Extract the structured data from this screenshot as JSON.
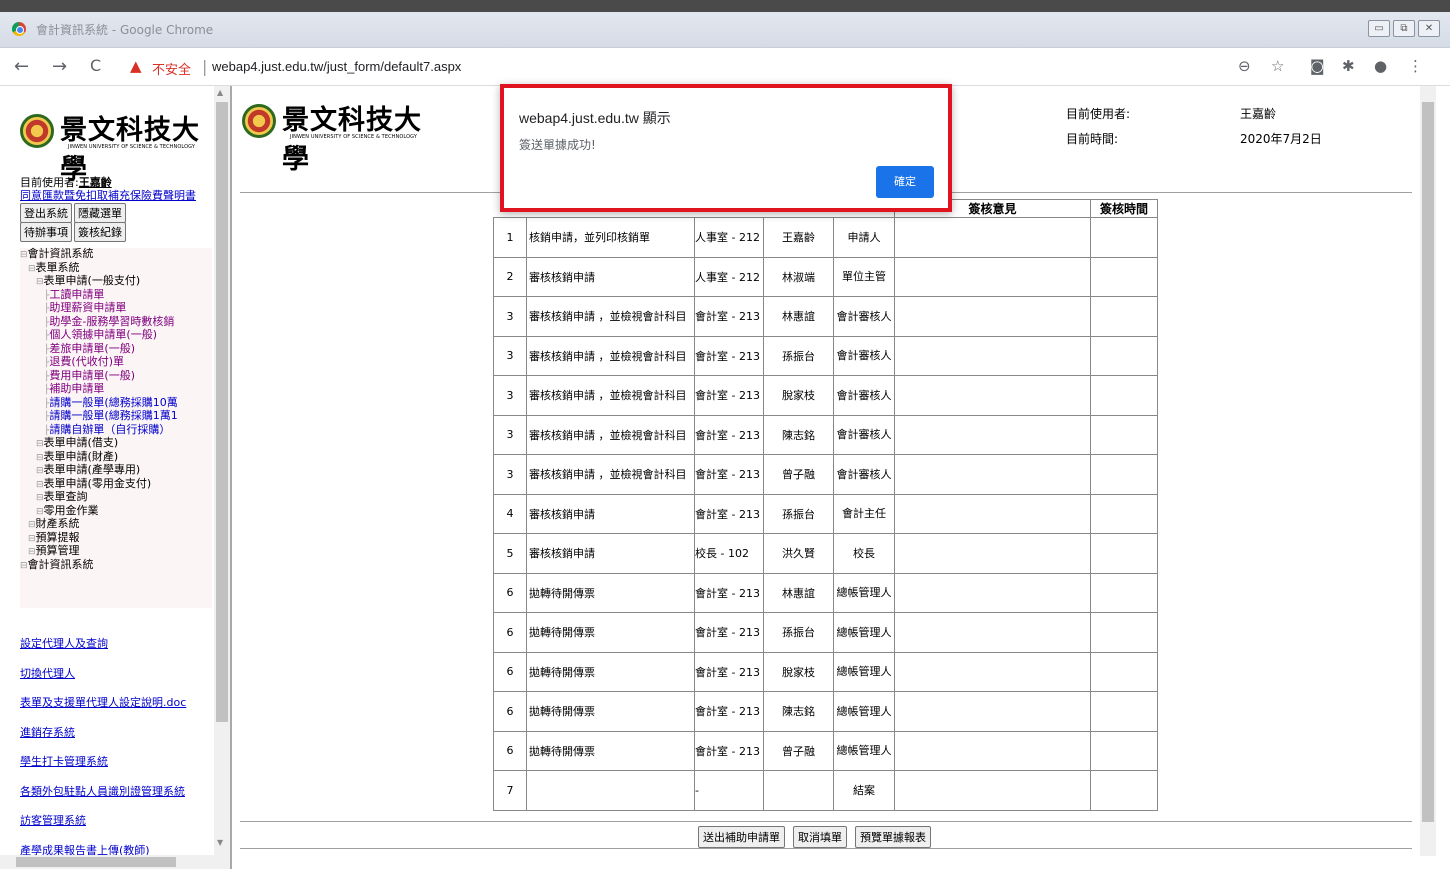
{
  "window": {
    "title": "會計資訊系統 - Google Chrome"
  },
  "browser": {
    "insecure_label": "不安全",
    "url": "webap4.just.edu.tw/just_form/default7.aspx"
  },
  "logo": {
    "cn": "景文科技大學",
    "en": "JINWEN UNIVERSITY OF SCIENCE & TECHNOLOGY"
  },
  "sidebar": {
    "user_label": "目前使用者:",
    "user_name": "王嘉齡",
    "consent_link": "同意匯款暨免扣取補充保險費聲明書",
    "buttons_row1": [
      "登出系統",
      "隱藏選單"
    ],
    "buttons_row2": [
      "待辦事項",
      "簽核紀錄"
    ],
    "tree": [
      {
        "label": "會計資訊系統",
        "level": 0,
        "type": "node"
      },
      {
        "label": "表單系統",
        "level": 1,
        "type": "node"
      },
      {
        "label": "表單申請(一般支付)",
        "level": 2,
        "type": "node"
      },
      {
        "label": "工讀申請單",
        "level": 3,
        "type": "visited"
      },
      {
        "label": "助理薪資申請單",
        "level": 3,
        "type": "visited"
      },
      {
        "label": "助學金-服務學習時數核銷",
        "level": 3,
        "type": "visited"
      },
      {
        "label": "個人領據申請單(一般)",
        "level": 3,
        "type": "visited"
      },
      {
        "label": "差旅申請單(一般)",
        "level": 3,
        "type": "visited"
      },
      {
        "label": "退費(代收付)單",
        "level": 3,
        "type": "visited"
      },
      {
        "label": "費用申請單(一般)",
        "level": 3,
        "type": "visited"
      },
      {
        "label": "補助申請單",
        "level": 3,
        "type": "visited"
      },
      {
        "label": "請購一般單(總務採購10萬",
        "level": 3,
        "type": "link"
      },
      {
        "label": "請購一般單(總務採購1萬1",
        "level": 3,
        "type": "link"
      },
      {
        "label": "請購自辦單（自行採購）",
        "level": 3,
        "type": "link"
      },
      {
        "label": "表單申請(借支)",
        "level": 2,
        "type": "node"
      },
      {
        "label": "表單申請(財產)",
        "level": 2,
        "type": "node"
      },
      {
        "label": "表單申請(產學專用)",
        "level": 2,
        "type": "node"
      },
      {
        "label": "表單申請(零用金支付)",
        "level": 2,
        "type": "node"
      },
      {
        "label": "表單查詢",
        "level": 2,
        "type": "node"
      },
      {
        "label": "零用金作業",
        "level": 2,
        "type": "node"
      },
      {
        "label": "財產系統",
        "level": 1,
        "type": "node"
      },
      {
        "label": "預算提報",
        "level": 1,
        "type": "node"
      },
      {
        "label": "預算管理",
        "level": 1,
        "type": "node"
      },
      {
        "label": "會計資訊系統",
        "level": 0,
        "type": "node"
      }
    ],
    "links": [
      "設定代理人及查詢",
      "切換代理人",
      "表單及支援單代理人設定說明.doc",
      "進銷存系統",
      "學生打卡管理系統",
      "各類外包駐點人員識別證管理系統",
      "訪客管理系統",
      "產學成果報告書上傳(教師)"
    ]
  },
  "header": {
    "user_label": "目前使用者:",
    "user_value": "王嘉齡",
    "time_label": "目前時間:",
    "time_value": "2020年7月2日"
  },
  "table": {
    "headers": [
      "簽核意見",
      "簽核時間"
    ],
    "rows": [
      {
        "no": "1",
        "action": "核銷申請，並列印核銷單",
        "unit": "人事室 - 212",
        "name": "王嘉齡",
        "role": "申請人"
      },
      {
        "no": "2",
        "action": "審核核銷申請",
        "unit": "人事室 - 212",
        "name": "林淑端",
        "role": "單位主管"
      },
      {
        "no": "3",
        "action": "審核核銷申請 ，並檢視會計科目",
        "unit": "會計室 - 213",
        "name": "林惠誼",
        "role": "會計審核人"
      },
      {
        "no": "3",
        "action": "審核核銷申請 ，並檢視會計科目",
        "unit": "會計室 - 213",
        "name": "孫振台",
        "role": "會計審核人"
      },
      {
        "no": "3",
        "action": "審核核銷申請 ，並檢視會計科目",
        "unit": "會計室 - 213",
        "name": "脫家枝",
        "role": "會計審核人"
      },
      {
        "no": "3",
        "action": "審核核銷申請 ，並檢視會計科目",
        "unit": "會計室 - 213",
        "name": "陳志銘",
        "role": "會計審核人"
      },
      {
        "no": "3",
        "action": "審核核銷申請 ，並檢視會計科目",
        "unit": "會計室 - 213",
        "name": "曾子融",
        "role": "會計審核人"
      },
      {
        "no": "4",
        "action": "審核核銷申請",
        "unit": "會計室 - 213",
        "name": "孫振台",
        "role": "會計主任"
      },
      {
        "no": "5",
        "action": "審核核銷申請",
        "unit": "校長 - 102",
        "name": "洪久賢",
        "role": "校長"
      },
      {
        "no": "6",
        "action": "拋轉待開傳票",
        "unit": "會計室 - 213",
        "name": "林惠誼",
        "role": "總帳管理人"
      },
      {
        "no": "6",
        "action": "拋轉待開傳票",
        "unit": "會計室 - 213",
        "name": "孫振台",
        "role": "總帳管理人"
      },
      {
        "no": "6",
        "action": "拋轉待開傳票",
        "unit": "會計室 - 213",
        "name": "脫家枝",
        "role": "總帳管理人"
      },
      {
        "no": "6",
        "action": "拋轉待開傳票",
        "unit": "會計室 - 213",
        "name": "陳志銘",
        "role": "總帳管理人"
      },
      {
        "no": "6",
        "action": "拋轉待開傳票",
        "unit": "會計室 - 213",
        "name": "曾子融",
        "role": "總帳管理人"
      },
      {
        "no": "7",
        "action": "",
        "unit": "-",
        "name": "",
        "role": "結案"
      }
    ]
  },
  "actions": {
    "submit": "送出補助申請單",
    "cancel": "取消填單",
    "preview": "預覽單據報表"
  },
  "dialog": {
    "title": "webap4.just.edu.tw 顯示",
    "message": "簽送單據成功!",
    "ok_label": "確定",
    "highlight_color": "#e0141e"
  }
}
